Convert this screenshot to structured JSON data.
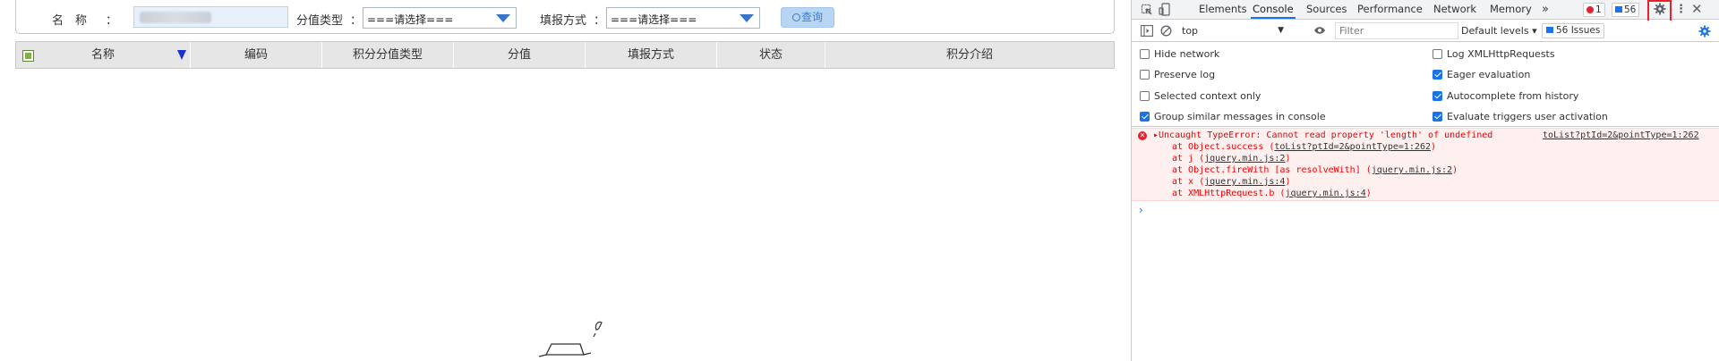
{
  "search": {
    "name_label": "名　称",
    "colon": "：",
    "score_type_label": "分值类型",
    "score_type_value": "===请选择===",
    "fill_method_label": "填报方式",
    "fill_method_value": "===请选择===",
    "query_button": "查询"
  },
  "grid": {
    "columns": [
      "名称",
      "编码",
      "积分分值类型",
      "分值",
      "填报方式",
      "状态",
      "积分介绍"
    ]
  },
  "devtools": {
    "tabs": [
      "Elements",
      "Console",
      "Sources",
      "Performance",
      "Network",
      "Memory"
    ],
    "active_tab": "Console",
    "more_tabs": "»",
    "error_count": "1",
    "message_count": "56",
    "context": "top",
    "filter_placeholder": "Filter",
    "levels": "Default levels ▾",
    "issues": "56 Issues",
    "settings": {
      "left": [
        {
          "label": "Hide network",
          "checked": false
        },
        {
          "label": "Preserve log",
          "checked": false
        },
        {
          "label": "Selected context only",
          "checked": false
        },
        {
          "label": "Group similar messages in console",
          "checked": true
        }
      ],
      "right": [
        {
          "label": "Log XMLHttpRequests",
          "checked": false
        },
        {
          "label": "Eager evaluation",
          "checked": true
        },
        {
          "label": "Autocomplete from history",
          "checked": true
        },
        {
          "label": "Evaluate triggers user activation",
          "checked": true
        }
      ]
    },
    "error": {
      "message": "▸Uncaught TypeError: Cannot read property 'length' of undefined",
      "source": "toList?ptId=2&pointType=1:262",
      "stack": [
        {
          "prefix": "at Object.success (",
          "link": "toList?ptId=2&pointType=1:262",
          "suffix": ")"
        },
        {
          "prefix": "at j (",
          "link": "jquery.min.js:2",
          "suffix": ")"
        },
        {
          "prefix": "at Object.fireWith [as resolveWith] (",
          "link": "jquery.min.js:2",
          "suffix": ")"
        },
        {
          "prefix": "at x (",
          "link": "jquery.min.js:4",
          "suffix": ")"
        },
        {
          "prefix": "at XMLHttpRequest.b (",
          "link": "jquery.min.js:4",
          "suffix": ")"
        }
      ]
    },
    "prompt": "›",
    "colors": {
      "accent": "#1a73e8",
      "error": "#e00000",
      "highlight": "#e8222a"
    }
  }
}
